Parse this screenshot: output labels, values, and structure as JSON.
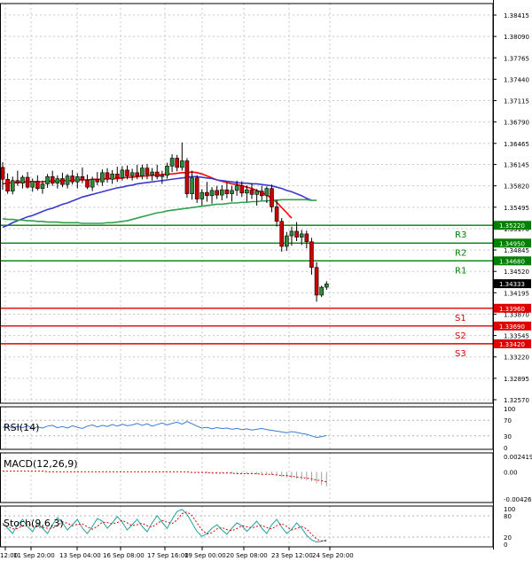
{
  "chart_data": {
    "type": "candlestick",
    "price_axis": {
      "ticks": [
        "1.38415",
        "1.38090",
        "1.37765",
        "1.37440",
        "1.37115",
        "1.36790",
        "1.36465",
        "1.36145",
        "1.35820",
        "1.35495",
        "1.35170",
        "1.34845",
        "1.34520",
        "1.34195",
        "1.33870",
        "1.33545",
        "1.33220",
        "1.32895",
        "1.32570"
      ],
      "ylim": [
        1.3257,
        1.38415
      ]
    },
    "x_axis": {
      "ticks": [
        "12:00",
        "11 Sep 20:00",
        "13 Sep 04:00",
        "16 Sep 08:00",
        "17 Sep 16:00",
        "19 Sep 00:00",
        "20 Sep 08:00",
        "23 Sep 12:00",
        "24 Sep 20:00"
      ]
    },
    "levels": [
      {
        "name": "R3",
        "value": 1.3522,
        "label": "1.35220",
        "color": "#008000"
      },
      {
        "name": "R2",
        "value": 1.3495,
        "label": "1.34950",
        "color": "#008000"
      },
      {
        "name": "R1",
        "value": 1.3468,
        "label": "1.34680",
        "color": "#008000"
      },
      {
        "name": "S1",
        "value": 1.3396,
        "label": "1.33960",
        "color": "#e00000"
      },
      {
        "name": "S2",
        "value": 1.3369,
        "label": "1.33690",
        "color": "#e00000"
      },
      {
        "name": "S3",
        "value": 1.3342,
        "label": "1.33420",
        "color": "#e00000"
      }
    ],
    "current_price": {
      "value": 1.34333,
      "label": "1.34333"
    },
    "candles": [
      [
        1.361,
        1.3618,
        1.3576,
        1.3592
      ],
      [
        1.3592,
        1.3601,
        1.357,
        1.3574
      ],
      [
        1.3574,
        1.3596,
        1.3569,
        1.359
      ],
      [
        1.359,
        1.3605,
        1.3582,
        1.3586
      ],
      [
        1.3586,
        1.3598,
        1.3578,
        1.3595
      ],
      [
        1.3595,
        1.3603,
        1.3578,
        1.358
      ],
      [
        1.358,
        1.3593,
        1.3573,
        1.3589
      ],
      [
        1.3589,
        1.3598,
        1.3575,
        1.3578
      ],
      [
        1.3578,
        1.359,
        1.357,
        1.3585
      ],
      [
        1.3585,
        1.36,
        1.3579,
        1.3596
      ],
      [
        1.3596,
        1.3605,
        1.3582,
        1.3586
      ],
      [
        1.3586,
        1.3598,
        1.3578,
        1.3593
      ],
      [
        1.3593,
        1.3602,
        1.358,
        1.3584
      ],
      [
        1.3584,
        1.36,
        1.3578,
        1.3597
      ],
      [
        1.3597,
        1.3606,
        1.3584,
        1.3588
      ],
      [
        1.3588,
        1.3601,
        1.3578,
        1.3596
      ],
      [
        1.3596,
        1.361,
        1.3586,
        1.3591
      ],
      [
        1.3591,
        1.3599,
        1.3577,
        1.358
      ],
      [
        1.358,
        1.3596,
        1.3574,
        1.3592
      ],
      [
        1.3592,
        1.3603,
        1.3583,
        1.3588
      ],
      [
        1.3588,
        1.3607,
        1.3582,
        1.3602
      ],
      [
        1.3602,
        1.3609,
        1.3587,
        1.3592
      ],
      [
        1.3592,
        1.3606,
        1.3585,
        1.36
      ],
      [
        1.36,
        1.3611,
        1.3588,
        1.3594
      ],
      [
        1.3594,
        1.3612,
        1.359,
        1.3606
      ],
      [
        1.3606,
        1.3613,
        1.3592,
        1.3597
      ],
      [
        1.3597,
        1.3608,
        1.359,
        1.3602
      ],
      [
        1.3602,
        1.3614,
        1.3592,
        1.3597
      ],
      [
        1.3597,
        1.3614,
        1.3592,
        1.3609
      ],
      [
        1.3609,
        1.3615,
        1.3592,
        1.3599
      ],
      [
        1.3599,
        1.3609,
        1.359,
        1.3603
      ],
      [
        1.3603,
        1.3614,
        1.3592,
        1.3596
      ],
      [
        1.3596,
        1.3605,
        1.3585,
        1.3598
      ],
      [
        1.3598,
        1.3617,
        1.3593,
        1.3612
      ],
      [
        1.3612,
        1.363,
        1.3603,
        1.3624
      ],
      [
        1.3624,
        1.3629,
        1.3604,
        1.361
      ],
      [
        1.361,
        1.3648,
        1.3605,
        1.362
      ],
      [
        1.362,
        1.3624,
        1.3564,
        1.357
      ],
      [
        1.357,
        1.3605,
        1.3561,
        1.3594
      ],
      [
        1.3594,
        1.3598,
        1.3556,
        1.3562
      ],
      [
        1.3562,
        1.3577,
        1.3552,
        1.3572
      ],
      [
        1.3572,
        1.3588,
        1.3558,
        1.3567
      ],
      [
        1.3567,
        1.358,
        1.3555,
        1.3575
      ],
      [
        1.3575,
        1.3582,
        1.3562,
        1.3568
      ],
      [
        1.3568,
        1.3583,
        1.356,
        1.3576
      ],
      [
        1.3576,
        1.3587,
        1.3563,
        1.357
      ],
      [
        1.357,
        1.3582,
        1.3558,
        1.3575
      ],
      [
        1.3575,
        1.359,
        1.3567,
        1.3582
      ],
      [
        1.3582,
        1.3589,
        1.3565,
        1.3571
      ],
      [
        1.3571,
        1.3583,
        1.3558,
        1.3576
      ],
      [
        1.3576,
        1.3586,
        1.3562,
        1.3569
      ],
      [
        1.3569,
        1.3577,
        1.3552,
        1.3574
      ],
      [
        1.3574,
        1.3582,
        1.356,
        1.3567
      ],
      [
        1.3567,
        1.3581,
        1.3556,
        1.3578
      ],
      [
        1.3578,
        1.3584,
        1.3542,
        1.355
      ],
      [
        1.355,
        1.3561,
        1.352,
        1.3528
      ],
      [
        1.3528,
        1.3533,
        1.3482,
        1.349
      ],
      [
        1.349,
        1.3512,
        1.3483,
        1.3506
      ],
      [
        1.3506,
        1.352,
        1.3491,
        1.3513
      ],
      [
        1.3513,
        1.3527,
        1.3498,
        1.3504
      ],
      [
        1.3504,
        1.3515,
        1.3492,
        1.3509
      ],
      [
        1.3509,
        1.3514,
        1.3487,
        1.3497
      ],
      [
        1.3497,
        1.3503,
        1.3447,
        1.3458
      ],
      [
        1.3458,
        1.3466,
        1.3406,
        1.3416
      ],
      [
        1.3416,
        1.343,
        1.3413,
        1.3428
      ],
      [
        1.3428,
        1.3437,
        1.3424,
        1.3433
      ]
    ],
    "moving_averages": [
      {
        "color": "#ff0000",
        "values": [
          1.3585,
          1.3586,
          1.3587,
          1.3587,
          1.3588,
          1.3588,
          1.3588,
          1.3588,
          1.3588,
          1.3589,
          1.3589,
          1.3589,
          1.359,
          1.359,
          1.359,
          1.3591,
          1.3591,
          1.3591,
          1.3592,
          1.3592,
          1.3592,
          1.3593,
          1.3593,
          1.3593,
          1.3594,
          1.3595,
          1.3595,
          1.3596,
          1.3597,
          1.3597,
          1.3598,
          1.3598,
          1.3599,
          1.36,
          1.36,
          1.3601,
          1.3602,
          1.3602,
          1.3603,
          1.3602,
          1.36,
          1.3597,
          1.3594,
          1.3591,
          1.3589,
          1.3587,
          1.3585,
          1.3584,
          1.3582,
          1.358,
          1.3578,
          1.3575,
          1.3572,
          1.3568,
          1.3563,
          1.3557,
          1.3549,
          1.3541,
          1.3533
        ]
      },
      {
        "color": "#3a3ad0",
        "values": [
          1.3519,
          1.3522,
          1.3526,
          1.3529,
          1.3532,
          1.3535,
          1.3537,
          1.354,
          1.3543,
          1.3546,
          1.3548,
          1.3551,
          1.3554,
          1.3556,
          1.3559,
          1.3562,
          1.3565,
          1.3567,
          1.3569,
          1.3571,
          1.3573,
          1.3575,
          1.3577,
          1.3579,
          1.358,
          1.3582,
          1.3583,
          1.3585,
          1.3586,
          1.3587,
          1.3588,
          1.3589,
          1.359,
          1.3591,
          1.3592,
          1.3593,
          1.3594,
          1.3595,
          1.3596,
          1.3596,
          1.3595,
          1.3594,
          1.3593,
          1.3591,
          1.359,
          1.3589,
          1.3588,
          1.3587,
          1.3586,
          1.3586,
          1.3585,
          1.3585,
          1.3584,
          1.3583,
          1.3582,
          1.358,
          1.3578,
          1.3575,
          1.3573,
          1.357,
          1.3567,
          1.3563,
          1.356
        ]
      },
      {
        "color": "#30a050",
        "values": [
          1.3532,
          1.3531,
          1.3531,
          1.353,
          1.353,
          1.3529,
          1.3529,
          1.3528,
          1.3528,
          1.3527,
          1.3527,
          1.3527,
          1.3526,
          1.3526,
          1.3526,
          1.3526,
          1.3525,
          1.3525,
          1.3525,
          1.3525,
          1.3525,
          1.3526,
          1.3526,
          1.3527,
          1.3528,
          1.3529,
          1.3531,
          1.3533,
          1.3535,
          1.3537,
          1.3539,
          1.3541,
          1.3542,
          1.3544,
          1.3545,
          1.3546,
          1.3547,
          1.3548,
          1.3549,
          1.355,
          1.3551,
          1.3552,
          1.3553,
          1.3554,
          1.3554,
          1.3555,
          1.3556,
          1.3556,
          1.3557,
          1.3557,
          1.3558,
          1.3558,
          1.3559,
          1.3559,
          1.356,
          1.356,
          1.3561,
          1.3561,
          1.3561,
          1.3561,
          1.3561,
          1.3561,
          1.356,
          1.356
        ]
      }
    ],
    "rsi": {
      "label": "RSI(14)",
      "ticks": [
        "100",
        "70",
        "30",
        "0"
      ],
      "ylim": [
        0,
        100
      ],
      "values": [
        52,
        55,
        50,
        54,
        51,
        56,
        49,
        53,
        50,
        55,
        57,
        51,
        54,
        50,
        56,
        52,
        49,
        55,
        58,
        53,
        57,
        54,
        59,
        55,
        60,
        56,
        58,
        62,
        57,
        61,
        55,
        59,
        63,
        58,
        62,
        65,
        60,
        67,
        61,
        55,
        50,
        52,
        48,
        51,
        49,
        50,
        47,
        49,
        46,
        48,
        45,
        47,
        49,
        46,
        44,
        42,
        40,
        38,
        41,
        39,
        36,
        34,
        30,
        26,
        28,
        31
      ]
    },
    "macd": {
      "label": "MACD(12,26,9)",
      "ticks": [
        "0.002419",
        "0.00",
        "-0.004269"
      ],
      "ylim": [
        -0.004269,
        0.002419
      ],
      "histogram": [
        0.0,
        0.0,
        0.0,
        0.0,
        0.0,
        0.0,
        0.0,
        0.0,
        0.0,
        0.0,
        0.0,
        0.0,
        0.0,
        0.0,
        0.0,
        0.0,
        0.0,
        0.0,
        0.0,
        0.0,
        0.0,
        0.0,
        0.0,
        0.0,
        0.0,
        0.0,
        0.0,
        0.0,
        0.0,
        0.0,
        0.0,
        0.0,
        0.0,
        0.0,
        0.0,
        0.0,
        0.0,
        0.0,
        0.0,
        -0.0001,
        -0.0002,
        -0.0002,
        -0.0002,
        -0.0002,
        -0.0002,
        -0.0003,
        -0.0003,
        -0.0003,
        -0.0003,
        -0.0003,
        -0.0003,
        -0.0004,
        -0.0004,
        -0.0004,
        -0.0005,
        -0.0006,
        -0.0008,
        -0.0009,
        -0.001,
        -0.0011,
        -0.0012,
        -0.0013,
        -0.0015,
        -0.0018,
        -0.0021,
        -0.0023
      ],
      "signal": [
        0.0001,
        0.0001,
        0.0001,
        0.0001,
        0.0001,
        0.0001,
        0.0001,
        0.0001,
        0.0001,
        0.0,
        0.0,
        0.0,
        0.0,
        0.0,
        0.0,
        0.0,
        0.0,
        0.0,
        0.0,
        0.0,
        0.0,
        0.0,
        0.0,
        0.0,
        0.0,
        0.0,
        0.0,
        0.0,
        0.0,
        0.0,
        0.0,
        0.0,
        0.0,
        0.0,
        0.0,
        0.0,
        0.0,
        0.0,
        -0.0001,
        -0.0001,
        -0.0001,
        -0.0001,
        -0.0002,
        -0.0002,
        -0.0002,
        -0.0002,
        -0.0002,
        -0.0003,
        -0.0003,
        -0.0003,
        -0.0003,
        -0.0003,
        -0.0004,
        -0.0004,
        -0.0004,
        -0.0005,
        -0.0006,
        -0.0006,
        -0.0007,
        -0.0008,
        -0.0009,
        -0.001,
        -0.0011,
        -0.0013,
        -0.0014,
        -0.0016
      ]
    },
    "stoch": {
      "label": "Stoch(9,6,3)",
      "ticks": [
        "100",
        "80",
        "20",
        "0"
      ],
      "ylim": [
        0,
        100
      ],
      "main": [
        60,
        45,
        30,
        55,
        70,
        50,
        35,
        60,
        45,
        30,
        55,
        75,
        60,
        40,
        55,
        70,
        45,
        30,
        50,
        72,
        65,
        45,
        60,
        78,
        62,
        40,
        55,
        70,
        50,
        35,
        60,
        80,
        62,
        44,
        70,
        92,
        98,
        84,
        60,
        36,
        22,
        30,
        45,
        55,
        40,
        28,
        45,
        60,
        52,
        36,
        50,
        65,
        45,
        30,
        55,
        70,
        48,
        30,
        42,
        60,
        45,
        25,
        12,
        6,
        8,
        12
      ],
      "signal": [
        55,
        50,
        43,
        44,
        52,
        58,
        52,
        48,
        47,
        45,
        45,
        53,
        63,
        59,
        52,
        56,
        57,
        49,
        42,
        50,
        62,
        61,
        57,
        61,
        67,
        60,
        52,
        55,
        59,
        52,
        48,
        58,
        67,
        62,
        58,
        68,
        86,
        91,
        81,
        60,
        40,
        29,
        32,
        43,
        47,
        41,
        38,
        44,
        52,
        49,
        46,
        50,
        53,
        47,
        43,
        52,
        58,
        50,
        40,
        44,
        50,
        43,
        28,
        14,
        9,
        9
      ]
    }
  }
}
